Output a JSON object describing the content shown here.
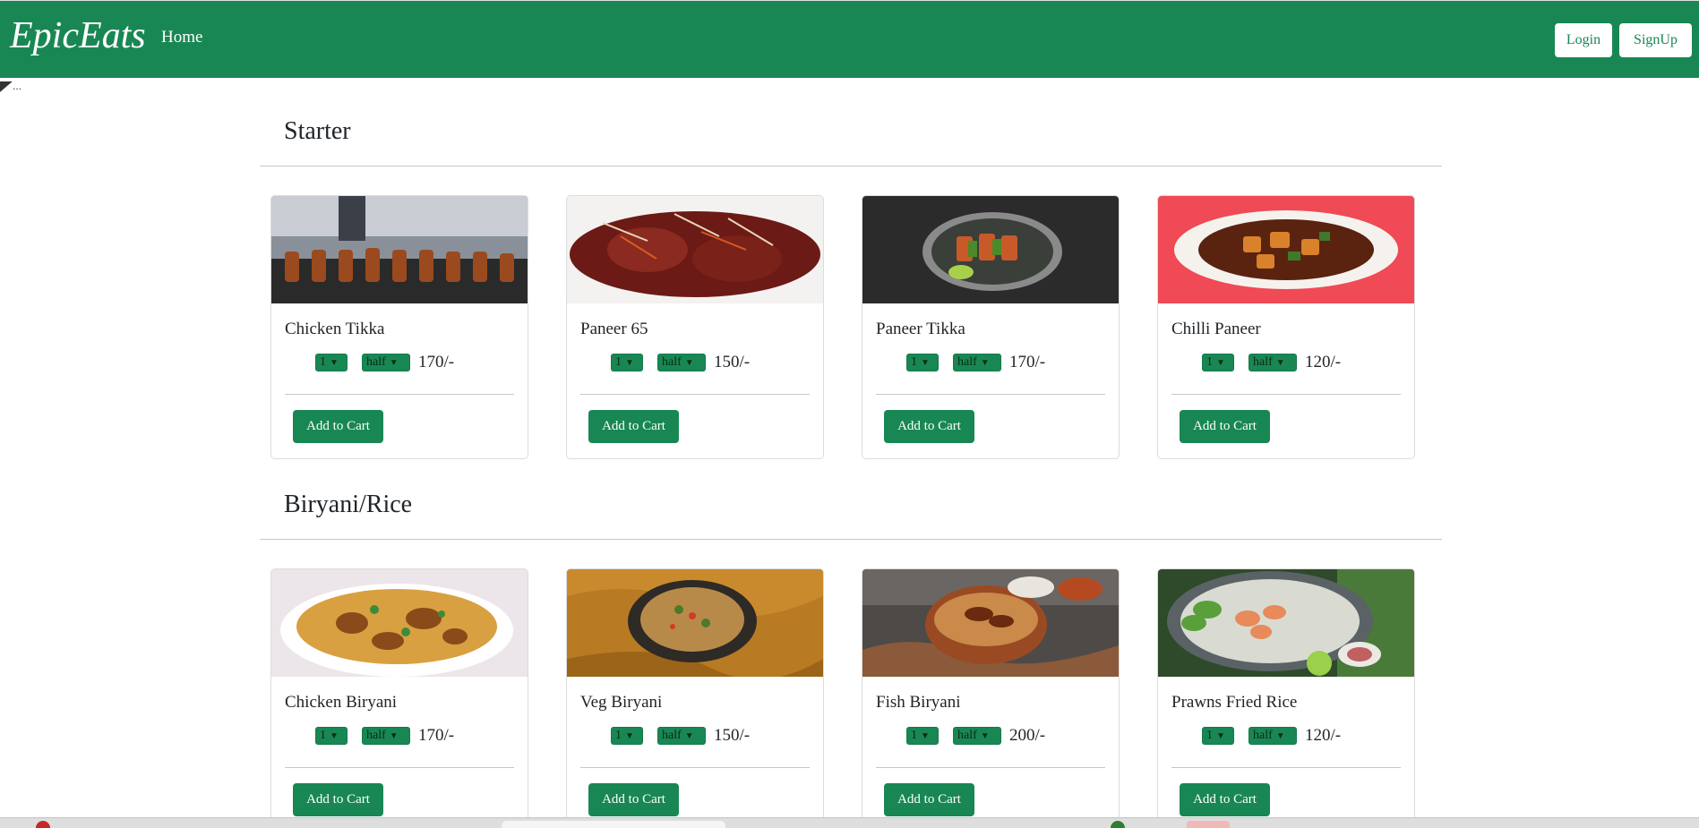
{
  "navbar": {
    "brand": "EpicEats",
    "home_label": "Home",
    "login_label": "Login",
    "signup_label": "SignUp"
  },
  "broken_image_alt": "...",
  "colors": {
    "brand_green": "#198754",
    "white": "#ffffff",
    "text": "#212529"
  },
  "sections": [
    {
      "title": "Starter",
      "items": [
        {
          "name": "Chicken Tikka",
          "qty": "1",
          "size": "half",
          "price": "170/-",
          "image_icon": "chicken-tikka-photo"
        },
        {
          "name": "Paneer 65",
          "qty": "1",
          "size": "half",
          "price": "150/-",
          "image_icon": "paneer-65-photo"
        },
        {
          "name": "Paneer Tikka",
          "qty": "1",
          "size": "half",
          "price": "170/-",
          "image_icon": "paneer-tikka-photo"
        },
        {
          "name": "Chilli Paneer",
          "qty": "1",
          "size": "half",
          "price": "120/-",
          "image_icon": "chilli-paneer-photo"
        }
      ]
    },
    {
      "title": "Biryani/Rice",
      "items": [
        {
          "name": "Chicken Biryani",
          "qty": "1",
          "size": "half",
          "price": "170/-",
          "image_icon": "chicken-biryani-photo"
        },
        {
          "name": "Veg Biryani",
          "qty": "1",
          "size": "half",
          "price": "150/-",
          "image_icon": "veg-biryani-photo"
        },
        {
          "name": "Fish Biryani",
          "qty": "1",
          "size": "half",
          "price": "200/-",
          "image_icon": "fish-biryani-photo"
        },
        {
          "name": "Prawns Fried Rice",
          "qty": "1",
          "size": "half",
          "price": "120/-",
          "image_icon": "prawns-fried-rice-photo"
        }
      ]
    }
  ],
  "add_to_cart_label": "Add to Cart"
}
